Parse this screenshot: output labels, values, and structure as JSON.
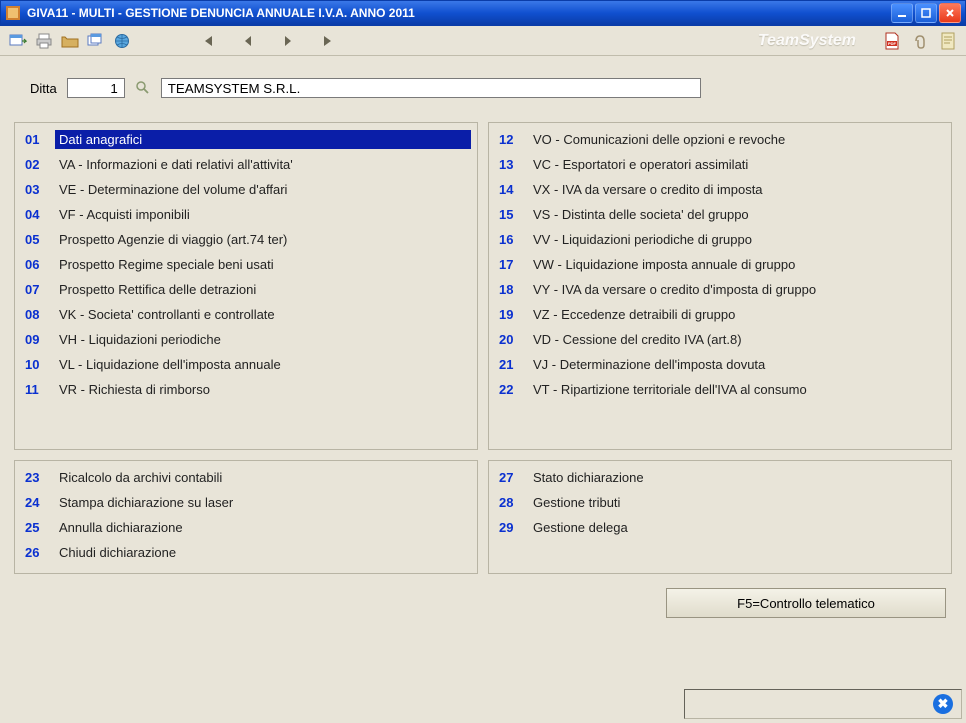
{
  "window": {
    "title": "GIVA11  - MULTI -  GESTIONE DENUNCIA ANNUALE I.V.A. ANNO 2011"
  },
  "toolbar": {
    "logo": "TeamSystem"
  },
  "ditta": {
    "label": "Ditta",
    "code": "1",
    "name": "TEAMSYSTEM S.R.L."
  },
  "menu": {
    "top_left": [
      {
        "num": "01",
        "label": "Dati anagrafici",
        "selected": true
      },
      {
        "num": "02",
        "label": "VA - Informazioni e dati relativi all'attivita'"
      },
      {
        "num": "03",
        "label": "VE - Determinazione del volume d'affari"
      },
      {
        "num": "04",
        "label": "VF - Acquisti imponibili"
      },
      {
        "num": "05",
        "label": "Prospetto Agenzie di viaggio (art.74 ter)"
      },
      {
        "num": "06",
        "label": "Prospetto Regime speciale beni usati"
      },
      {
        "num": "07",
        "label": "Prospetto Rettifica delle detrazioni"
      },
      {
        "num": "08",
        "label": "VK - Societa' controllanti e controllate"
      },
      {
        "num": "09",
        "label": "VH - Liquidazioni periodiche"
      },
      {
        "num": "10",
        "label": "VL - Liquidazione dell'imposta annuale"
      },
      {
        "num": "11",
        "label": "VR - Richiesta di rimborso"
      }
    ],
    "top_right": [
      {
        "num": "12",
        "label": "VO - Comunicazioni delle opzioni e revoche"
      },
      {
        "num": "13",
        "label": "VC - Esportatori e operatori assimilati"
      },
      {
        "num": "14",
        "label": "VX - IVA da versare o credito di imposta"
      },
      {
        "num": "15",
        "label": "VS - Distinta delle societa' del gruppo"
      },
      {
        "num": "16",
        "label": "VV - Liquidazioni periodiche di gruppo"
      },
      {
        "num": "17",
        "label": "VW - Liquidazione imposta annuale di gruppo"
      },
      {
        "num": "18",
        "label": "VY - IVA da versare o credito d'imposta di gruppo"
      },
      {
        "num": "19",
        "label": "VZ - Eccedenze detraibili di gruppo"
      },
      {
        "num": "20",
        "label": "VD - Cessione del credito IVA (art.8)"
      },
      {
        "num": "21",
        "label": "VJ - Determinazione dell'imposta dovuta"
      },
      {
        "num": "22",
        "label": "VT - Ripartizione territoriale dell'IVA al consumo"
      }
    ],
    "bottom_left": [
      {
        "num": "23",
        "label": "Ricalcolo da archivi contabili"
      },
      {
        "num": "24",
        "label": "Stampa dichiarazione su laser"
      },
      {
        "num": "25",
        "label": "Annulla dichiarazione"
      },
      {
        "num": "26",
        "label": "Chiudi dichiarazione"
      }
    ],
    "bottom_right": [
      {
        "num": "27",
        "label": "Stato dichiarazione"
      },
      {
        "num": "28",
        "label": "Gestione tributi"
      },
      {
        "num": "29",
        "label": "Gestione delega"
      }
    ]
  },
  "footer": {
    "button": "F5=Controllo telematico"
  }
}
